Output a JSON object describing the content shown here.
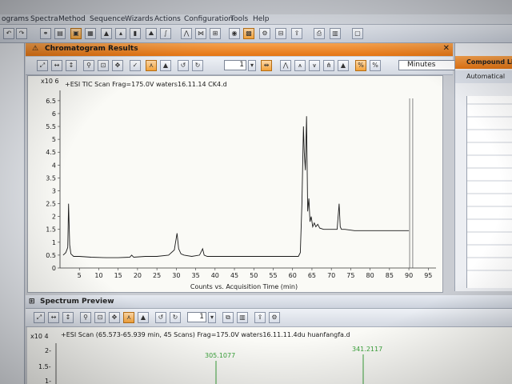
{
  "menu": [
    "ograms",
    "Spectra",
    "Method",
    "Sequence",
    "Wizards",
    "Actions",
    "Configuration",
    "Tools",
    "Help"
  ],
  "chromatogram_panel": {
    "title": "Chromatogram Results",
    "page_number": "1",
    "time_units": "Minutes"
  },
  "compound_panel": {
    "title": "Compound List",
    "automatic_label": "Automatical"
  },
  "spectrum_panel": {
    "title": "Spectrum Preview",
    "page_number": "1",
    "trace_label": "+ESI Scan (65.573-65.939 min, 45 Scans) Frag=175.0V waters16.11.11.4du huanfangfa.d",
    "y_scale": "x10 4",
    "peak_labels": [
      "305.1077",
      "341.2117"
    ]
  },
  "chart_data": {
    "type": "line",
    "title": "+ESI TIC Scan Frag=175.0V waters16.11.14 CK4.d",
    "y_scale_label": "x10 6",
    "xlabel": "Counts vs. Acquisition Time (min)",
    "ylabel": "",
    "xlim": [
      0,
      97
    ],
    "ylim": [
      0,
      6.9
    ],
    "x_ticks": [
      5,
      10,
      15,
      20,
      25,
      30,
      35,
      40,
      45,
      50,
      55,
      60,
      65,
      70,
      75,
      80,
      85,
      90,
      95
    ],
    "y_ticks": [
      0,
      0.5,
      1,
      1.5,
      2,
      2.5,
      3,
      3.5,
      4,
      4.5,
      5,
      5.5,
      6,
      6.5
    ],
    "series": [
      {
        "color": "#1a1a1a",
        "x": [
          0.8,
          1.5,
          2.0,
          2.2,
          2.5,
          2.8,
          3.5,
          5,
          8,
          12,
          15,
          18,
          18.5,
          19,
          22,
          25,
          28,
          29.5,
          30.2,
          30.6,
          31.2,
          32,
          34,
          36,
          36.8,
          37.2,
          38,
          42,
          48,
          55,
          60,
          61.5,
          62,
          62.4,
          62.8,
          63.0,
          63.3,
          63.6,
          63.9,
          64.2,
          64.5,
          64.8,
          65.2,
          65.6,
          66.0,
          66.5,
          67,
          68,
          70,
          71.5,
          72.0,
          72.3,
          72.6,
          73.5,
          76,
          80,
          84,
          88,
          90
        ],
        "y": [
          0.5,
          0.6,
          0.8,
          2.5,
          0.9,
          0.55,
          0.45,
          0.45,
          0.42,
          0.4,
          0.4,
          0.42,
          0.5,
          0.42,
          0.45,
          0.45,
          0.5,
          0.7,
          1.35,
          0.75,
          0.55,
          0.5,
          0.45,
          0.5,
          0.75,
          0.5,
          0.45,
          0.45,
          0.45,
          0.45,
          0.45,
          0.45,
          0.6,
          2.5,
          5.5,
          4.5,
          3.8,
          5.9,
          2.2,
          2.7,
          1.8,
          2.0,
          1.6,
          1.75,
          1.6,
          1.7,
          1.55,
          1.5,
          1.5,
          1.5,
          2.5,
          1.6,
          1.5,
          1.5,
          1.45,
          1.45,
          1.45,
          1.45,
          1.45
        ]
      }
    ],
    "grid": false,
    "legend": "none"
  }
}
